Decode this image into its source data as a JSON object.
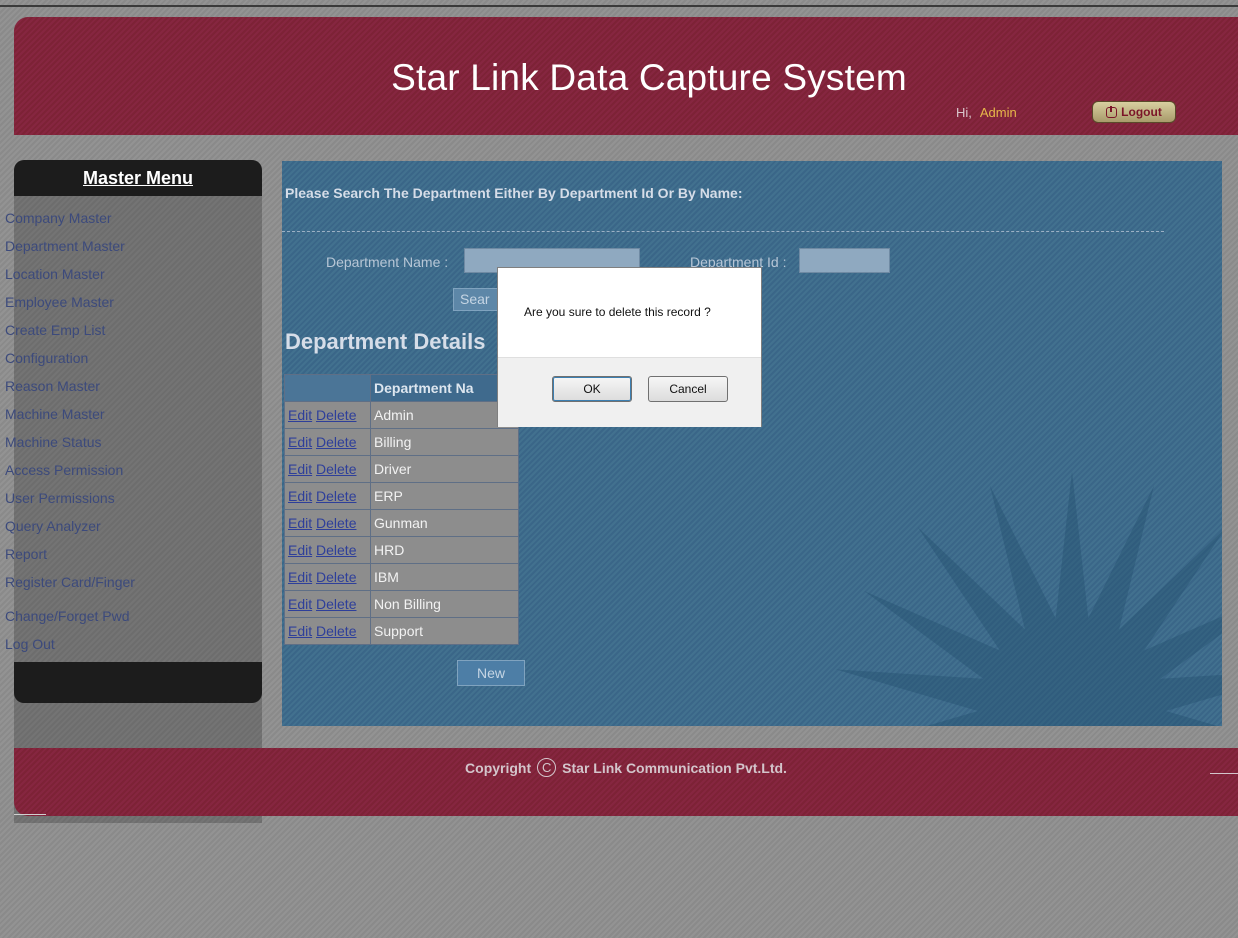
{
  "header": {
    "title": "Star Link Data Capture System",
    "greeting": "Hi,",
    "user": "Admin",
    "logout_label": "Logout"
  },
  "sidebar": {
    "title": "Master Menu",
    "items": [
      {
        "label": "Company Master"
      },
      {
        "label": "Department Master"
      },
      {
        "label": "Location Master"
      },
      {
        "label": "Employee Master"
      },
      {
        "label": "Create Emp List"
      },
      {
        "label": "Configuration"
      },
      {
        "label": "Reason Master"
      },
      {
        "label": "Machine Master"
      },
      {
        "label": "Machine Status"
      },
      {
        "label": "Access Permission"
      },
      {
        "label": "User Permissions"
      },
      {
        "label": "Query Analyzer"
      },
      {
        "label": "Report"
      },
      {
        "label": "Register Card/Finger"
      },
      {
        "label": "Change/Forget Pwd"
      },
      {
        "label": "Log Out"
      }
    ]
  },
  "search": {
    "heading": "Please Search The Department Either By Department Id Or By Name:",
    "name_label": "Department Name :",
    "name_value": "",
    "id_label": "Department Id :",
    "id_value": "",
    "button_label": "Sear"
  },
  "details": {
    "heading": "Department Details",
    "column_name": "Department Na",
    "edit_label": "Edit",
    "delete_label": "Delete",
    "rows": [
      "Admin",
      "Billing",
      "Driver",
      "ERP",
      "Gunman",
      "HRD",
      "IBM",
      "Non Billing",
      "Support"
    ],
    "new_label": "New"
  },
  "dialog": {
    "message": "Are you sure to delete this record ?",
    "ok_label": "OK",
    "cancel_label": "Cancel"
  },
  "footer": {
    "copyright_label": "Copyright",
    "copyright_symbol": "C",
    "company": "Star Link Communication Pvt.Ltd."
  },
  "colors": {
    "header_bg": "#7d2236",
    "main_bg": "#3a6688",
    "sidebar_dark": "#1c1c1c",
    "greeting_user": "#e7b84a"
  }
}
